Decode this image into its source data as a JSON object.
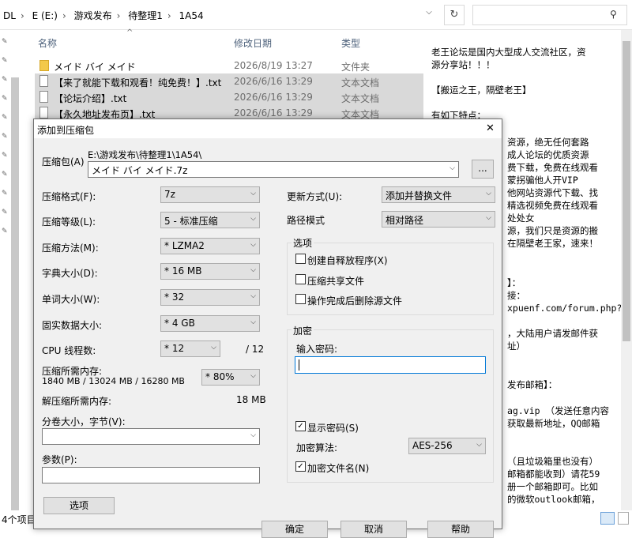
{
  "address": {
    "crumbs": [
      "DL",
      "E (E:)",
      "游戏发布",
      "待整理1",
      "1A54"
    ]
  },
  "list": {
    "headers": {
      "name": "名称",
      "date": "修改日期",
      "type": "类型"
    },
    "rows": [
      {
        "name": "メイド バイ メイド",
        "date": "2026/8/19 13:27",
        "type": "文件夹"
      },
      {
        "name": "【来了就能下载和观看！纯免费！】.txt",
        "date": "2026/6/16 13:29",
        "type": "文本文档"
      },
      {
        "name": "【论坛介绍】.txt",
        "date": "2026/6/16 13:29",
        "type": "文本文档"
      },
      {
        "name": "【永久地址发布页】.txt",
        "date": "2026/6/16 13:29",
        "type": "文本文档"
      }
    ]
  },
  "status": {
    "items": "4个项目"
  },
  "preview": {
    "lines": [
      "老王论坛是国内大型成人交流社区，资",
      "源分享站！！！",
      "【搬运之王，隔壁老王】",
      "有如下特点：",
      "资源，绝无任何套路",
      "成人论坛的优质资源",
      "费下载，免费在线观看",
      "蒙拐骗他人开VIP",
      "他网站资源代下载、找",
      "精选视频免费在线观看",
      "处处女",
      "源，我们只是资源的搬",
      "在隔壁老王家，速来！",
      "】：",
      "接：",
      "xpuenf.com/forum.php?",
      "，大陆用户请发邮件获",
      "址）",
      "发布邮箱】：",
      "ag.vip （发送任意内容",
      "获取最新地址，QQ邮箱",
      "（且垃圾箱里也没有）",
      "邮箱都能收到）请花59",
      "册一个邮箱即可。比如",
      "的微软outlook邮箱，"
    ]
  },
  "dialog": {
    "title": "添加到压缩包",
    "archive_label": "压缩包(A)",
    "archive_path": "E:\\游戏发布\\待整理1\\1A54\\",
    "archive_name": "メイド バイ メイド.7z",
    "browse": "...",
    "format_label": "压缩格式(F):",
    "format_value": "7z",
    "level_label": "压缩等级(L):",
    "level_value": "5 - 标准压缩",
    "method_label": "压缩方法(M):",
    "method_value": "* LZMA2",
    "dict_label": "字典大小(D):",
    "dict_value": "* 16 MB",
    "word_label": "单词大小(W):",
    "word_value": "* 32",
    "solid_label": "固实数据大小:",
    "solid_value": "* 4 GB",
    "cpu_label": "CPU 线程数:",
    "cpu_value": "* 12",
    "cpu_total": "/ 12",
    "mem_label": "压缩所需内存:",
    "mem_detail": "1840 MB / 13024 MB / 16280 MB",
    "mem_value": "* 80%",
    "decomp_label": "解压缩所需内存:",
    "decomp_value": "18 MB",
    "split_label": "分卷大小，字节(V):",
    "params_label": "参数(P):",
    "options_button": "选项",
    "update_label": "更新方式(U):",
    "update_value": "添加并替换文件",
    "path_label": "路径模式",
    "path_value": "相对路径",
    "options_group": "选项",
    "opt_sfx": "创建自释放程序(X)",
    "opt_shared": "压缩共享文件",
    "opt_delete": "操作完成后删除源文件",
    "enc_group": "加密",
    "pw_label": "输入密码:",
    "show_pw": "显示密码(S)",
    "enc_method_label": "加密算法:",
    "enc_method_value": "AES-256",
    "enc_names": "加密文件名(N)",
    "ok": "确定",
    "cancel": "取消",
    "help": "帮助",
    "close": "✕"
  }
}
